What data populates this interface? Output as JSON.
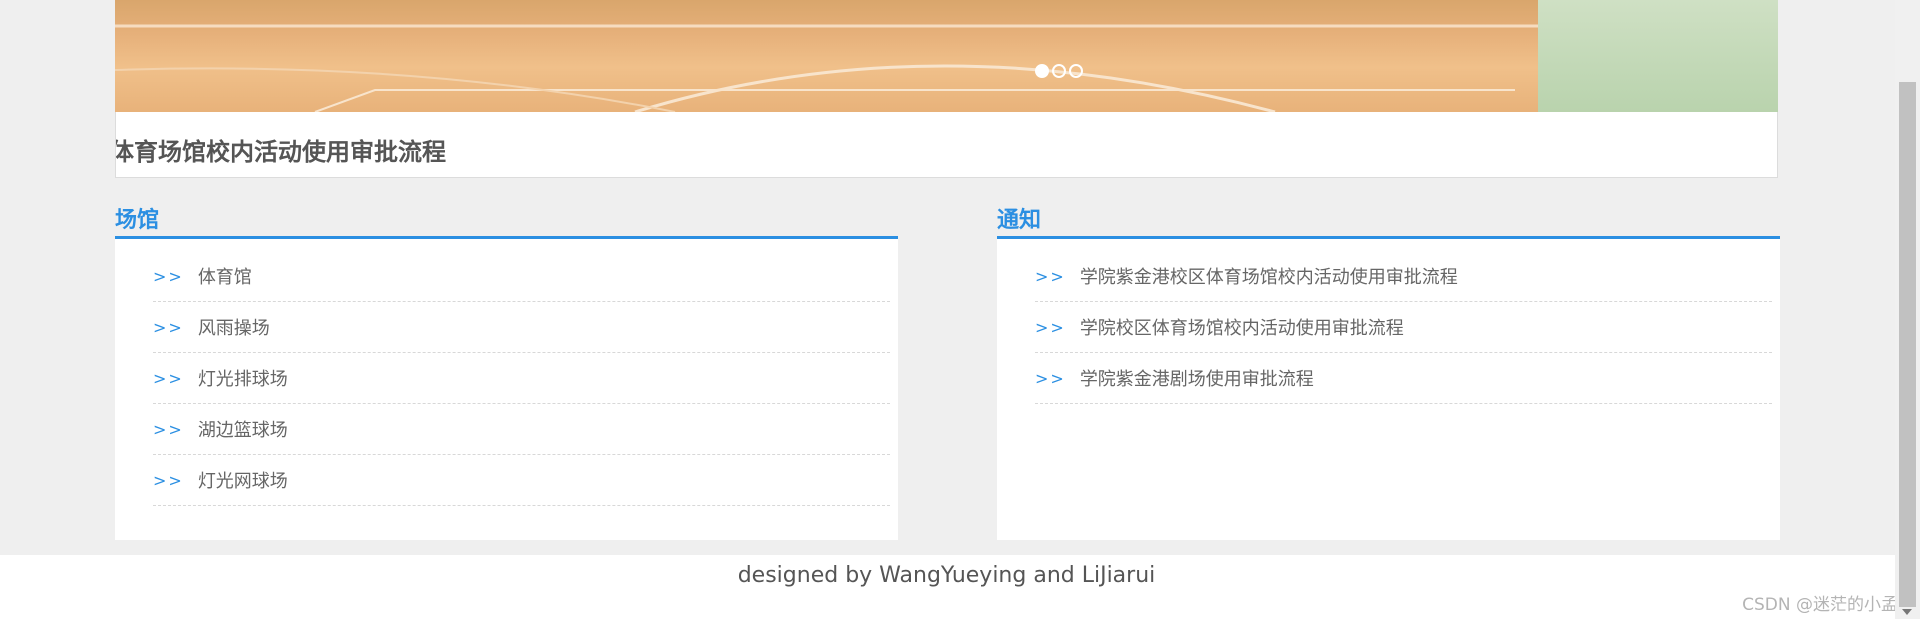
{
  "banner": {
    "dots": [
      {
        "active": true
      },
      {
        "active": false
      },
      {
        "active": false
      }
    ]
  },
  "article_title": "体育场馆校内活动使用审批流程",
  "venues": {
    "heading": "场馆",
    "arrow": ">>",
    "items": [
      {
        "label": "体育馆"
      },
      {
        "label": "风雨操场"
      },
      {
        "label": "灯光排球场"
      },
      {
        "label": "湖边篮球场"
      },
      {
        "label": "灯光网球场"
      }
    ]
  },
  "notices": {
    "heading": "通知",
    "arrow": ">>",
    "items": [
      {
        "label": "学院紫金港校区体育场馆校内活动使用审批流程"
      },
      {
        "label": "学院校区体育场馆校内活动使用审批流程"
      },
      {
        "label": "学院紫金港剧场使用审批流程"
      }
    ]
  },
  "footer": {
    "credit": "designed by WangYueying and LiJiarui"
  },
  "watermark": "CSDN @迷茫的小孟",
  "colors": {
    "accent": "#2b8fe2",
    "background": "#efefef"
  }
}
